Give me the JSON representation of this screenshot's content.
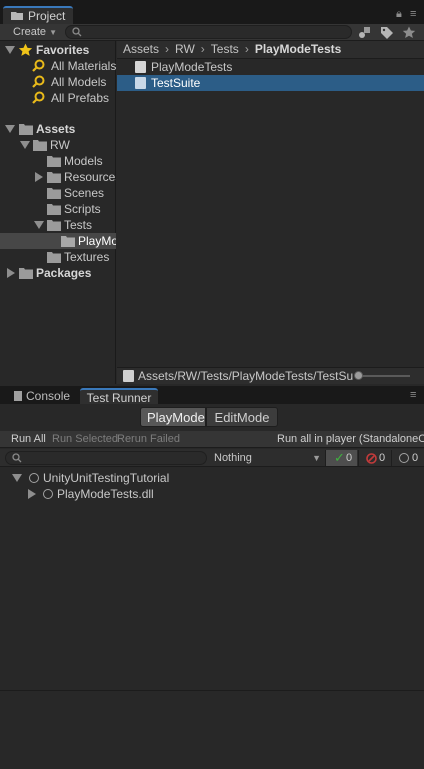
{
  "project_window": {
    "tab_label": "Project",
    "create_label": "Create",
    "search_placeholder": "",
    "favorites": {
      "label": "Favorites",
      "items": [
        "All Materials",
        "All Models",
        "All Prefabs"
      ]
    },
    "assets_tree": {
      "assets_label": "Assets",
      "rw_label": "RW",
      "children": [
        "Models",
        "Resources",
        "Scenes",
        "Scripts",
        "Tests",
        "Textures"
      ],
      "tests_child": "PlayMo",
      "packages_label": "Packages"
    },
    "breadcrumb": {
      "items": [
        "Assets",
        "RW",
        "Tests"
      ],
      "current": "PlayModeTests"
    },
    "files": [
      {
        "name": "PlayModeTests",
        "selected": false
      },
      {
        "name": "TestSuite",
        "selected": true
      }
    ],
    "path_bar": "Assets/RW/Tests/PlayModeTests/TestSu"
  },
  "test_runner": {
    "tabs": [
      "Console",
      "Test Runner"
    ],
    "active_tab": "Test Runner",
    "modes": [
      "PlayMode",
      "EditMode"
    ],
    "active_mode": "PlayMode",
    "run_all": "Run All",
    "run_selected": "Run Selected",
    "rerun_failed": "Rerun Failed",
    "run_all_player": "Run all in player (StandaloneOSX)",
    "search_placeholder": "",
    "category_filter": "Nothing",
    "counts": {
      "passed": "0",
      "failed": "0",
      "not_run": "0"
    },
    "tree": [
      {
        "label": "UnityUnitTestingTutorial",
        "level": 0,
        "expanded": true
      },
      {
        "label": "PlayModeTests.dll",
        "level": 1,
        "expanded": false
      }
    ]
  },
  "colors": {
    "accent": "#3a79bb",
    "selection": "#2c5d87",
    "passed": "#3fb13f",
    "failed": "#c33b3b",
    "star": "#f0c419",
    "folder": "#9b9b9b"
  }
}
